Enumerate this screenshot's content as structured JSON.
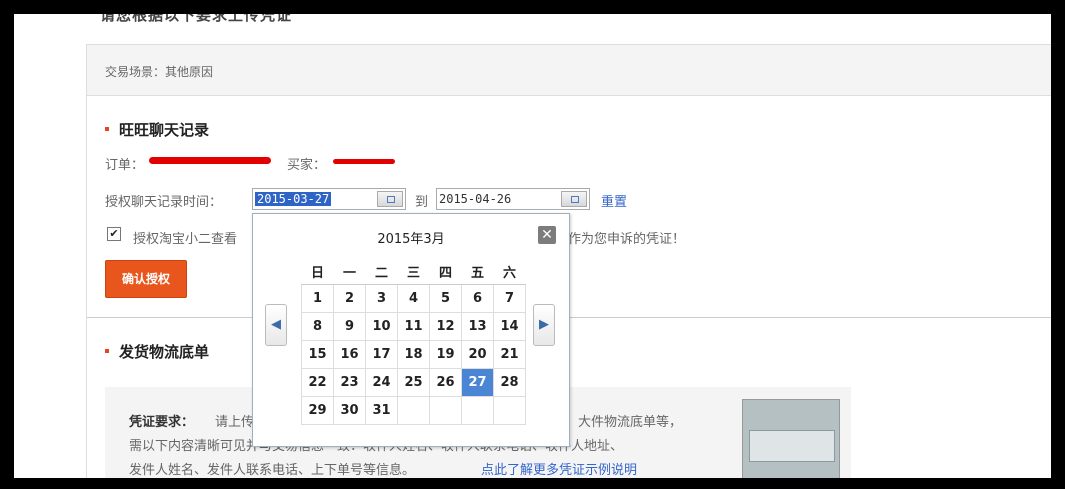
{
  "header": {
    "title": "请您根据以下要求上传凭证"
  },
  "scene": {
    "label": "交易场景：其他原因"
  },
  "wangwang": {
    "title": "旺旺聊天记录",
    "order_label": "订单：",
    "buyer_label": "买家：",
    "time_label": "授权聊天记录时间：",
    "date_from": "2015-03-27",
    "to_label": "到",
    "date_to": "2015-04-26",
    "reset_label": "重置",
    "auth_prefix": "授权淘宝小二查看",
    "auth_suffix": "，作为您申诉的凭证！",
    "auth_checked": true,
    "confirm_label": "确认授权"
  },
  "calendar": {
    "title": "2015年3月",
    "close": "✕",
    "prev": "◀",
    "next": "▶",
    "weekdays": [
      "日",
      "一",
      "二",
      "三",
      "四",
      "五",
      "六"
    ],
    "weeks": [
      [
        "1",
        "2",
        "3",
        "4",
        "5",
        "6",
        "7"
      ],
      [
        "8",
        "9",
        "10",
        "11",
        "12",
        "13",
        "14"
      ],
      [
        "15",
        "16",
        "17",
        "18",
        "19",
        "20",
        "21"
      ],
      [
        "22",
        "23",
        "24",
        "25",
        "26",
        "27",
        "28"
      ],
      [
        "29",
        "30",
        "31",
        "",
        "",
        "",
        ""
      ]
    ],
    "selected": "27"
  },
  "logistics": {
    "title": "发货物流底单",
    "req_label": "凭证要求：",
    "req_line1_start": "请上传",
    "req_line1_end": "、大件物流底单等，",
    "req_line2": "需以下内容清晰可见并与交易信息一致：收件人姓名、收件人联系电话、收件人地址、",
    "req_line3": "发件人姓名、发件人联系电话、上下单号等信息。",
    "example_link": "点此了解更多凭证示例说明"
  },
  "colors": {
    "accent": "#e8561d",
    "link": "#3366cc",
    "selected_day": "#4a86d4"
  }
}
